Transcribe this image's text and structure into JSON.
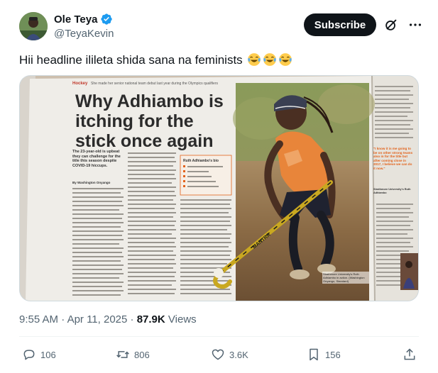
{
  "author": {
    "display_name": "Ole Teya",
    "handle": "@TeyaKevin",
    "verified": true
  },
  "header": {
    "subscribe_label": "Subscribe",
    "grok_icon": "grok-icon",
    "more_icon": "more-horizontal-icon"
  },
  "tweet": {
    "text": "Hii headline ilileta shida sana na feminists",
    "emojis": [
      "face-with-tears-of-joy",
      "face-with-tears-of-joy",
      "face-with-tears-of-joy"
    ]
  },
  "media": {
    "section_tag": "Hockey",
    "kicker": "She made her senior national team debut last year during the Olympics qualifiers",
    "headline_line1": "Why Adhiambo is",
    "headline_line2": "itching for the",
    "headline_line3": "stick once again",
    "standfirst": "The 23-year-old is upbeat they can challenge for the title this season despite COVID-19 hiccups.",
    "byline": "By Washington Onyango",
    "bio_title": "Ruth Adhiambo's bio",
    "pull_quote": "\"I know it is me going to be on other strong teams also in for the title but after coming close in 2017, I believe we can do it now.\"",
    "pull_quote_credit": "Strathmore University's Ruth Adhiambo",
    "caption": "Strathmore University's Ruth Adhiambo in action. (Washington Onyango, Standard)",
    "stick_brand": "MANTRA"
  },
  "meta": {
    "time": "9:55 AM",
    "separator": "·",
    "date": "Apr 11, 2025",
    "views_count": "87.9K",
    "views_label": "Views"
  },
  "actions": {
    "replies": "106",
    "reposts": "806",
    "likes": "3.6K",
    "bookmarks": "156"
  },
  "colors": {
    "text_primary": "#0f1419",
    "text_secondary": "#536471",
    "verified_blue": "#1d9bf0",
    "headline_ink": "#2b2b2b",
    "accent_orange": "#e2621b"
  }
}
